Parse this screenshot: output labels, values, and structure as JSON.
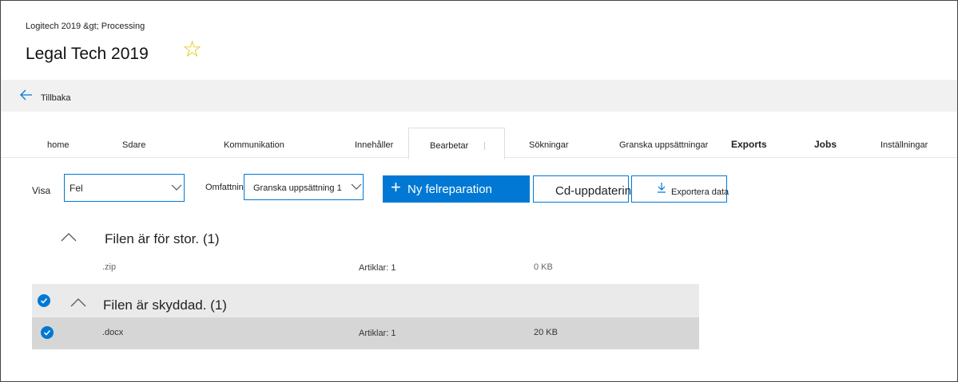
{
  "header": {
    "breadcrumb": "Logitech 2019 &gt; Processing",
    "title": "Legal Tech 2019",
    "favorite_icon": "star-outline-icon"
  },
  "back": {
    "label": "Tillbaka",
    "icon": "arrow-left-icon"
  },
  "tabs": [
    {
      "label": "home"
    },
    {
      "label": "Sdare"
    },
    {
      "label": "Kommunikation"
    },
    {
      "label": "Innehåller"
    },
    {
      "label": "Bearbetar",
      "active": true
    },
    {
      "label": "Sökningar"
    },
    {
      "label": "Granska uppsättningar"
    },
    {
      "label": "Exports"
    },
    {
      "label": "Jobs"
    },
    {
      "label": "Inställningar"
    }
  ],
  "toolbar": {
    "visa_label": "Visa",
    "visa_value": "Fel",
    "omfattning_label": "Omfattning:",
    "omfattning_value": "Granska uppsättning 1",
    "new_repair_label": "Ny felreparation",
    "cd_update_label": "Cd-uppdatering",
    "export_label": "Exportera data"
  },
  "groups": [
    {
      "title": "Filen är för stor. (1)",
      "selected": false,
      "rows": [
        {
          "name": ".zip",
          "items": "Artiklar: 1",
          "size": "0 KB"
        }
      ]
    },
    {
      "title": "Filen är skyddad. (1)",
      "selected": true,
      "rows": [
        {
          "name": ".docx",
          "items": "Artiklar: 1",
          "size": "20 KB"
        }
      ]
    }
  ],
  "colors": {
    "accent": "#0078d4",
    "star": "#e6c200",
    "backbar": "#f1f1f1"
  }
}
